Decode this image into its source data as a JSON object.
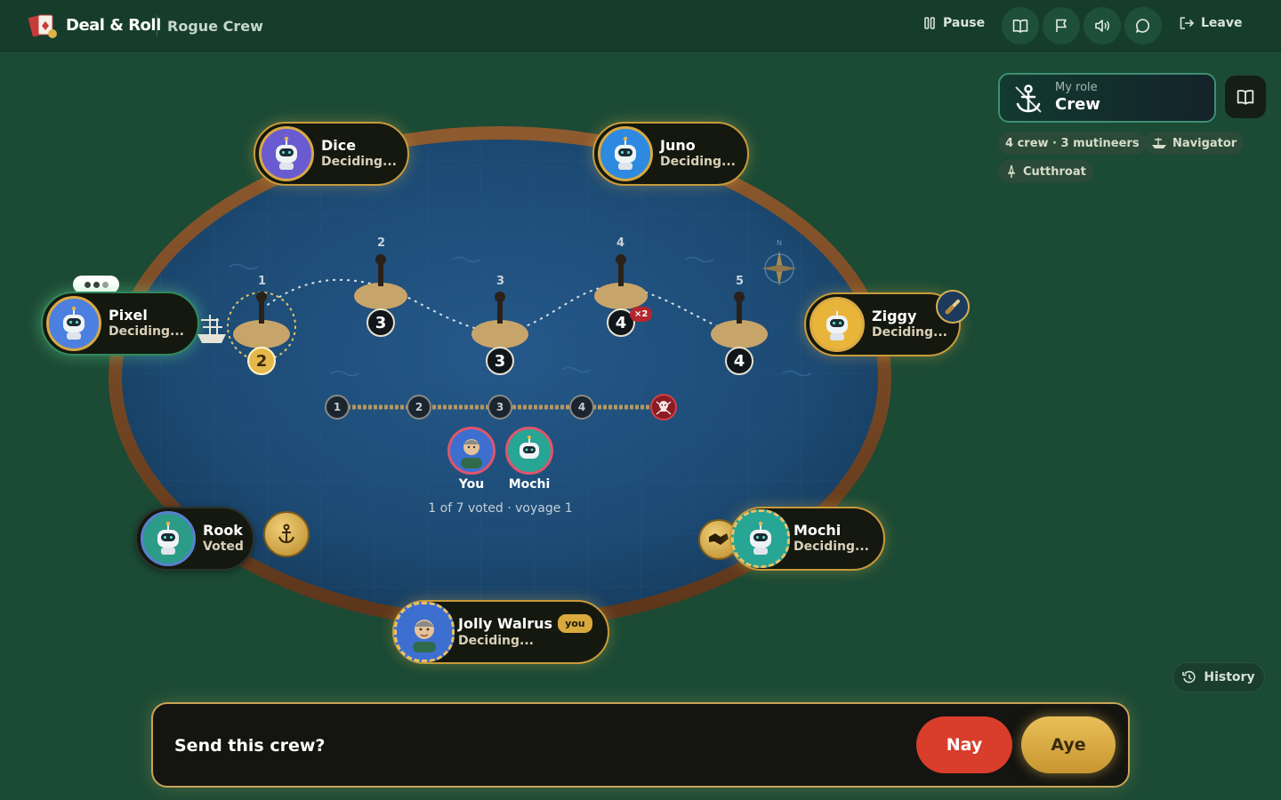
{
  "app": {
    "name": "Deal & Roll",
    "room": "Rogue Crew"
  },
  "toolbar": {
    "pause_label": "Pause",
    "icons": [
      "book-icon",
      "flag-icon",
      "sound-icon",
      "chat-icon"
    ],
    "leave_label": "Leave"
  },
  "role": {
    "label": "My role",
    "value": "Crew"
  },
  "chips": {
    "composition": "4 crew · 3 mutineers",
    "navigator": "Navigator",
    "cutthroat": "Cutthroat"
  },
  "players": [
    {
      "name": "Dice",
      "status": "Deciding..."
    },
    {
      "name": "Juno",
      "status": "Deciding..."
    },
    {
      "name": "Pixel",
      "status": "Deciding..."
    },
    {
      "name": "Ziggy",
      "status": "Deciding..."
    },
    {
      "name": "Rook",
      "status": "Voted"
    },
    {
      "name": "Mochi",
      "status": "Deciding..."
    },
    {
      "name": "Jolly Walrus",
      "status": "Deciding...",
      "badge": "you"
    }
  ],
  "voyage": {
    "islands": [
      {
        "number": "1",
        "crew_needed": "2"
      },
      {
        "number": "2",
        "crew_needed": "3"
      },
      {
        "number": "3",
        "crew_needed": "3"
      },
      {
        "number": "4",
        "crew_needed": "4",
        "modifier": "×2"
      },
      {
        "number": "5",
        "crew_needed": "4"
      }
    ],
    "track": [
      "1",
      "2",
      "3",
      "4"
    ],
    "compass_letter": "N"
  },
  "proposed_crew": [
    {
      "name": "You"
    },
    {
      "name": "Mochi"
    }
  ],
  "vote_status": "1 of 7 voted · voyage 1",
  "vote": {
    "question": "Send this crew?",
    "nay": "Nay",
    "aye": "Aye"
  },
  "history_label": "History",
  "colors": {
    "felt": "#1b4a35",
    "gold": "#c89a3a",
    "nay": "#d93d2c",
    "aye": "#e2b44c",
    "sea": "#1e4e7a"
  }
}
